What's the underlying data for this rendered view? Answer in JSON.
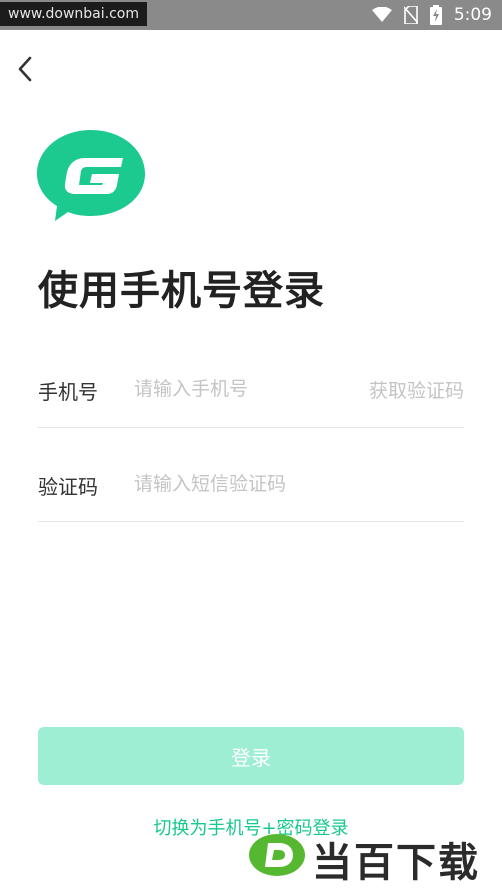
{
  "status_bar": {
    "watermark": "www.downbai.com",
    "time": "5:09",
    "icons": [
      "wifi-icon",
      "no-sim-icon",
      "battery-charging-icon"
    ]
  },
  "header": {
    "back_icon": "chevron-left-icon"
  },
  "logo": {
    "icon": "g-chat-bubble-logo",
    "color": "#1cc98e"
  },
  "page": {
    "title": "使用手机号登录"
  },
  "phone": {
    "label": "手机号",
    "placeholder": "请输入手机号",
    "value": "",
    "get_code": "获取验证码"
  },
  "code": {
    "label": "验证码",
    "placeholder": "请输入短信验证码",
    "value": ""
  },
  "login_button": {
    "label": "登录",
    "color": "#9deed3"
  },
  "switch_link": "切换为手机号+密码登录",
  "watermark_bottom": {
    "text": "当百下载",
    "logo": "d-logo",
    "color": "#56b830"
  },
  "colors": {
    "accent": "#16c88a",
    "placeholder": "#c4c4c4"
  }
}
